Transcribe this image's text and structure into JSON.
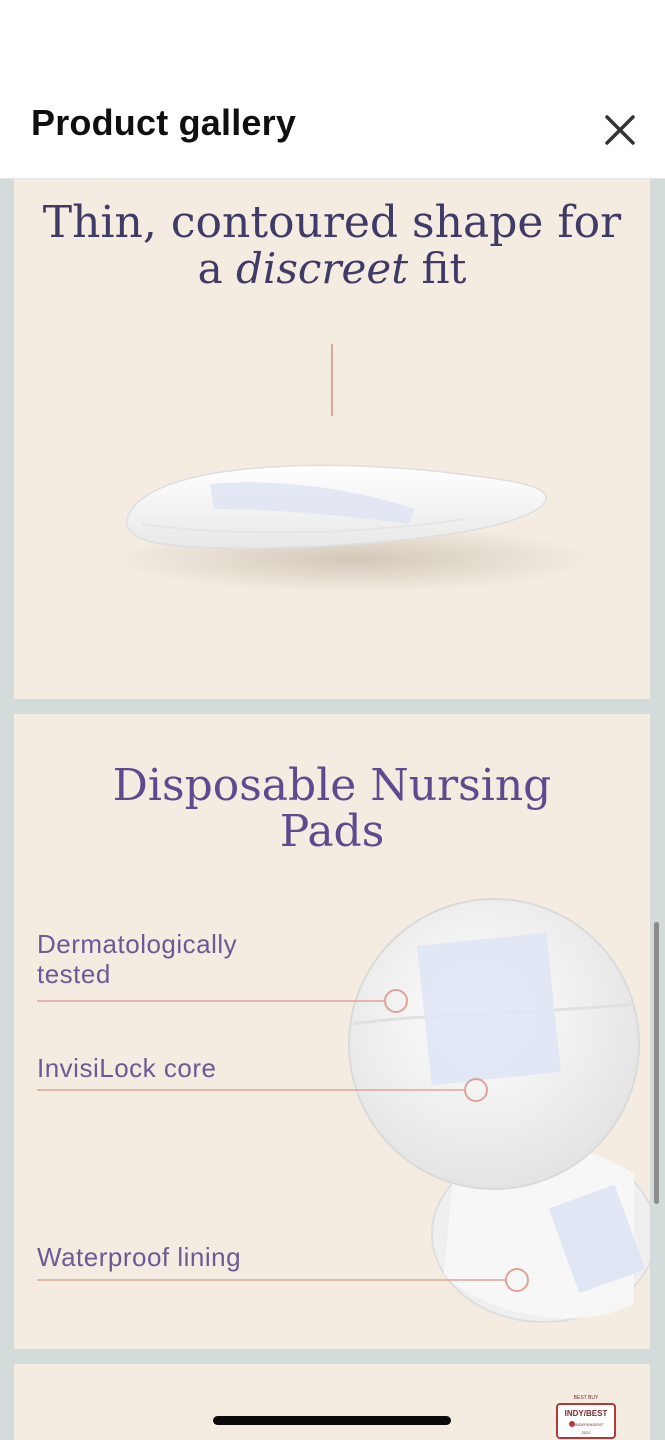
{
  "header": {
    "title": "Product gallery",
    "close_icon": "close-icon"
  },
  "images": [
    {
      "headline_line1": "Thin, contoured shape for",
      "headline_line2_prefix": "a ",
      "headline_line2_italic": "discreet",
      "headline_line2_suffix": " fit"
    },
    {
      "headline_line1": "Disposable Nursing",
      "headline_line2": "Pads",
      "features": [
        "Dermatologically",
        "tested",
        "InvisiLock core",
        "Waterproof lining"
      ]
    },
    {
      "badge_top": "BEST BUY",
      "badge_main": "INDY/BEST",
      "badge_sub": "INDEPENDENT",
      "badge_year": "2022"
    }
  ],
  "colors": {
    "card_bg": "#f4ece1",
    "gallery_bg": "#d3dbdb",
    "headline": "#3f3a66",
    "feature_text": "#6a5b94",
    "callout_line": "#e0a39b"
  }
}
